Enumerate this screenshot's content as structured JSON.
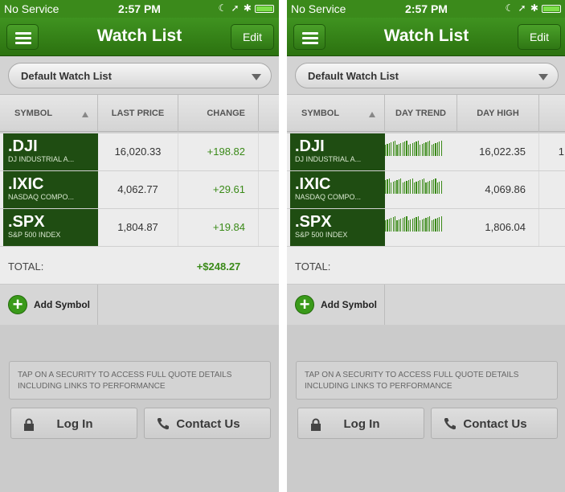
{
  "status_bar": {
    "carrier": "No Service",
    "time": "2:57 PM"
  },
  "nav": {
    "title": "Watch List",
    "edit_label": "Edit"
  },
  "watchlist_picker": {
    "selected": "Default Watch List"
  },
  "left_grid": {
    "columns": [
      "SYMBOL",
      "LAST PRICE",
      "CHANGE"
    ],
    "rows": [
      {
        "symbol": ".DJI",
        "name": "DJ INDUSTRIAL A...",
        "last_price": "16,020.33",
        "change": "+198.82"
      },
      {
        "symbol": ".IXIC",
        "name": "NASDAQ COMPO...",
        "last_price": "4,062.77",
        "change": "+29.61"
      },
      {
        "symbol": ".SPX",
        "name": "S&P 500 INDEX",
        "last_price": "1,804.87",
        "change": "+19.84"
      }
    ],
    "total_label": "TOTAL:",
    "total_value": "+$248.27"
  },
  "right_grid": {
    "columns": [
      "SYMBOL",
      "DAY TREND",
      "DAY HIGH"
    ],
    "rows": [
      {
        "symbol": ".DJI",
        "name": "DJ INDUSTRIAL A...",
        "day_high": "16,022.35",
        "overflow": "1"
      },
      {
        "symbol": ".IXIC",
        "name": "NASDAQ COMPO...",
        "day_high": "4,069.86",
        "overflow": ""
      },
      {
        "symbol": ".SPX",
        "name": "S&P 500 INDEX",
        "day_high": "1,806.04",
        "overflow": ""
      }
    ],
    "total_label": "TOTAL:"
  },
  "add_symbol_label": "Add Symbol",
  "info_text": "TAP ON A SECURITY TO ACCESS FULL QUOTE DETAILS INCLUDING LINKS TO PERFORMANCE",
  "buttons": {
    "login": "Log In",
    "contact": "Contact Us"
  },
  "colors": {
    "brand_green": "#3b8a1b",
    "symbol_bg": "#1f4d12",
    "positive": "#3a8a18"
  }
}
